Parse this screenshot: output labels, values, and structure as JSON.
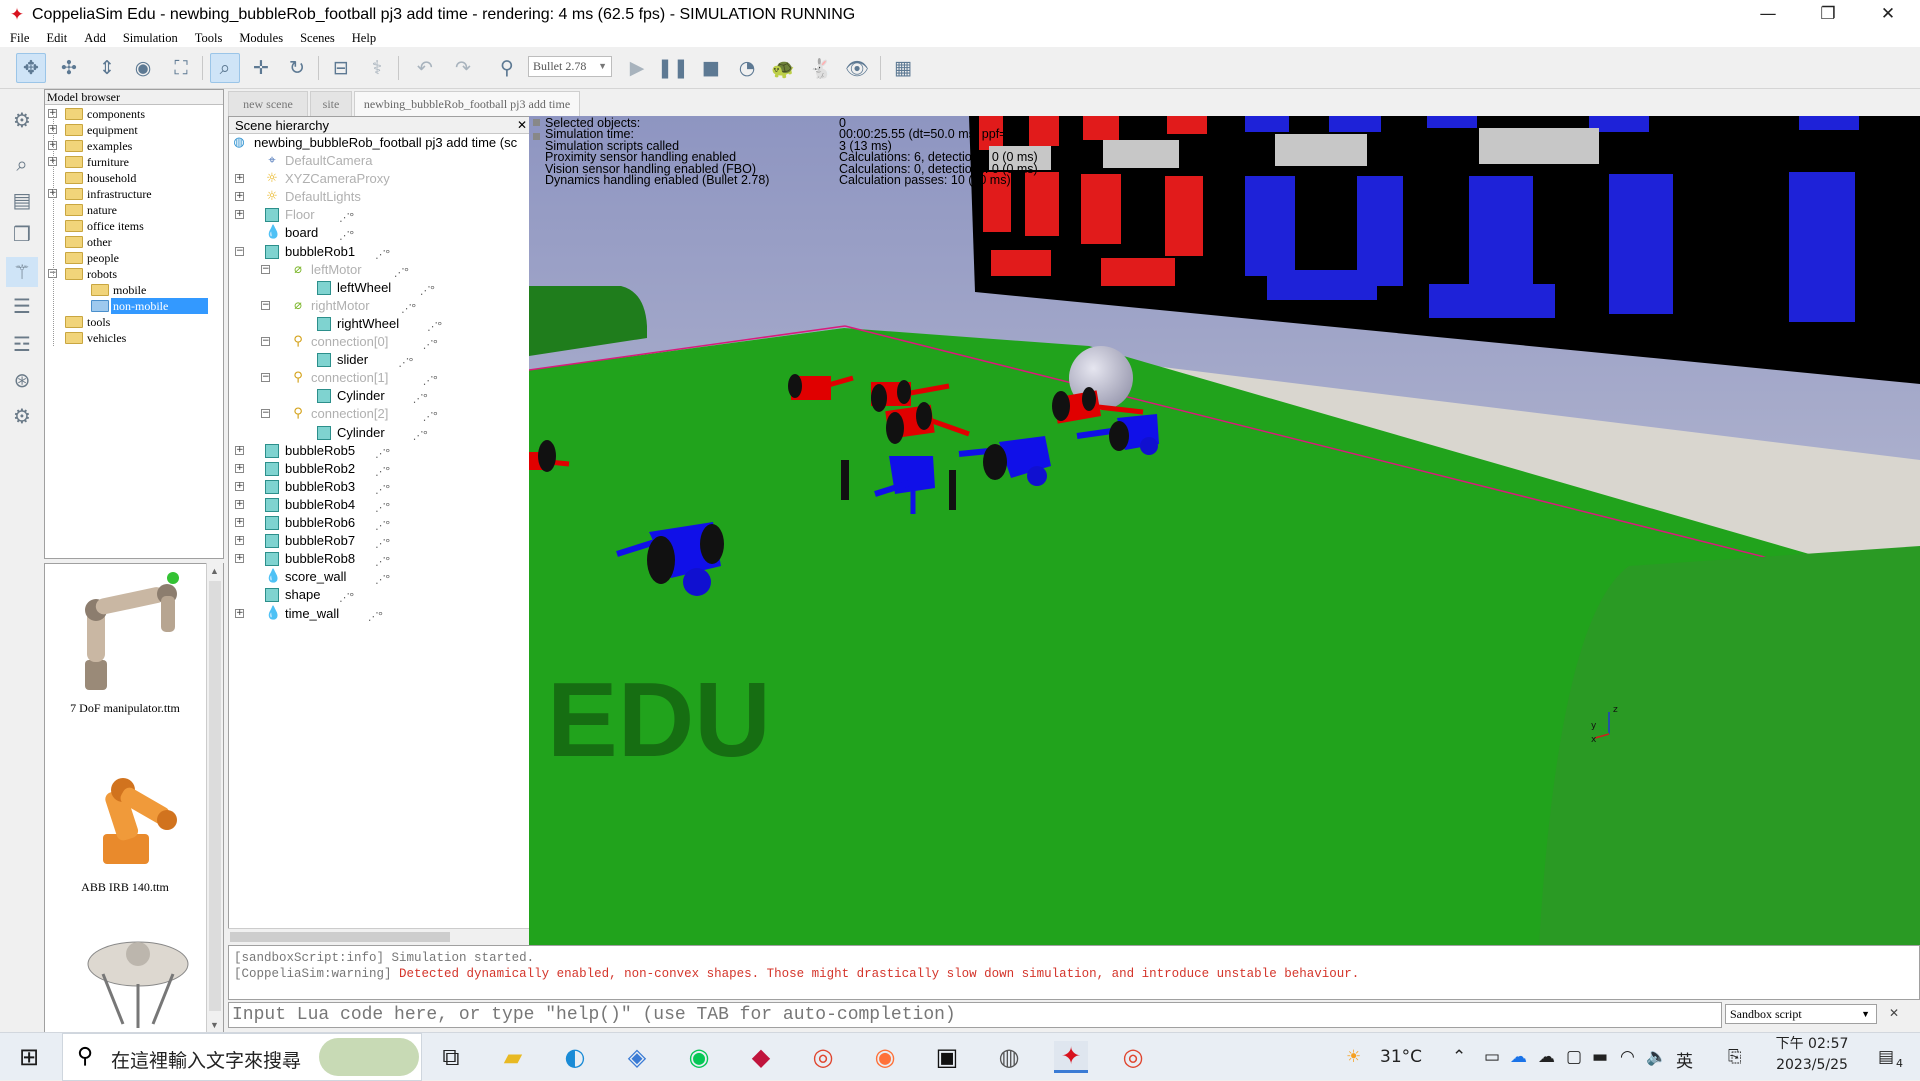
{
  "window": {
    "title": "CoppeliaSim Edu - newbing_bubbleRob_football pj3 add time - rendering: 4 ms (62.5 fps) - SIMULATION RUNNING",
    "minimize": "—",
    "maximize": "❐",
    "close": "✕"
  },
  "menu": [
    "File",
    "Edit",
    "Add",
    "Simulation",
    "Tools",
    "Modules",
    "Scenes",
    "Help"
  ],
  "toolbar": {
    "engine": "Bullet 2.78",
    "icons": [
      "camera-pan-icon",
      "camera-rotate-icon",
      "camera-shift-icon",
      "camera-angle-icon",
      "fit-to-view-icon",
      "click-select-icon",
      "object-shift-icon",
      "object-rotate-icon",
      "assemble-icon",
      "transfer-dna-icon",
      "undo-icon",
      "redo-icon",
      "engine-settings-icon",
      "start-simulation-icon",
      "pause-simulation-icon",
      "stop-simulation-icon",
      "real-time-icon",
      "slow-down-icon",
      "speed-up-icon",
      "visualization-icon",
      "page-selector-icon"
    ]
  },
  "model_browser": {
    "header": "Model browser",
    "folders": [
      {
        "label": "components",
        "expander": "+"
      },
      {
        "label": "equipment",
        "expander": "+"
      },
      {
        "label": "examples",
        "expander": "+"
      },
      {
        "label": "furniture",
        "expander": "+"
      },
      {
        "label": "household",
        "expander": ""
      },
      {
        "label": "infrastructure",
        "expander": "+"
      },
      {
        "label": "nature",
        "expander": ""
      },
      {
        "label": "office items",
        "expander": ""
      },
      {
        "label": "other",
        "expander": ""
      },
      {
        "label": "people",
        "expander": ""
      },
      {
        "label": "robots",
        "expander": "−"
      },
      {
        "label": "mobile",
        "expander": "",
        "child": true
      },
      {
        "label": "non-mobile",
        "expander": "",
        "child": true,
        "selected": true
      },
      {
        "label": "tools",
        "expander": ""
      },
      {
        "label": "vehicles",
        "expander": ""
      }
    ],
    "thumbnails": [
      "7 DoF manipulator.ttm",
      "ABB IRB 140.ttm"
    ]
  },
  "scene_tabs": [
    "new scene",
    "site",
    "newbing_bubbleRob_football pj3 add time"
  ],
  "hierarchy": {
    "header": "Scene hierarchy",
    "close": "✕",
    "root": "newbing_bubbleRob_football pj3 add time (sc",
    "items": [
      {
        "label": "DefaultCamera",
        "icon": "cam",
        "grey": true,
        "depth": 1,
        "exp": ""
      },
      {
        "label": "XYZCameraProxy",
        "icon": "light",
        "grey": true,
        "depth": 1,
        "exp": "+"
      },
      {
        "label": "DefaultLights",
        "icon": "light",
        "grey": true,
        "depth": 1,
        "exp": "+"
      },
      {
        "label": "Floor",
        "icon": "cube",
        "grey": true,
        "depth": 1,
        "exp": "+",
        "script": true
      },
      {
        "label": "board",
        "icon": "shape",
        "grey": false,
        "depth": 1,
        "exp": "",
        "script": true
      },
      {
        "label": "bubbleRob1",
        "icon": "cube",
        "grey": false,
        "depth": 1,
        "exp": "−",
        "script": true
      },
      {
        "label": "leftMotor",
        "icon": "joint",
        "grey": true,
        "depth": 2,
        "exp": "−",
        "script": true
      },
      {
        "label": "leftWheel",
        "icon": "cube",
        "grey": false,
        "depth": 3,
        "exp": "",
        "script": true
      },
      {
        "label": "rightMotor",
        "icon": "joint",
        "grey": true,
        "depth": 2,
        "exp": "−",
        "script": true
      },
      {
        "label": "rightWheel",
        "icon": "cube",
        "grey": false,
        "depth": 3,
        "exp": "",
        "script": true
      },
      {
        "label": "connection[0]",
        "icon": "force",
        "grey": true,
        "depth": 2,
        "exp": "−",
        "script": true
      },
      {
        "label": "slider",
        "icon": "cube",
        "grey": false,
        "depth": 3,
        "exp": "",
        "script": true
      },
      {
        "label": "connection[1]",
        "icon": "force",
        "grey": true,
        "depth": 2,
        "exp": "−",
        "script": true
      },
      {
        "label": "Cylinder",
        "icon": "cube",
        "grey": false,
        "depth": 3,
        "exp": "",
        "script": true
      },
      {
        "label": "connection[2]",
        "icon": "force",
        "grey": true,
        "depth": 2,
        "exp": "−",
        "script": true
      },
      {
        "label": "Cylinder",
        "icon": "cube",
        "grey": false,
        "depth": 3,
        "exp": "",
        "script": true
      },
      {
        "label": "bubbleRob5",
        "icon": "cube",
        "grey": false,
        "depth": 1,
        "exp": "+",
        "script": true
      },
      {
        "label": "bubbleRob2",
        "icon": "cube",
        "grey": false,
        "depth": 1,
        "exp": "+",
        "script": true
      },
      {
        "label": "bubbleRob3",
        "icon": "cube",
        "grey": false,
        "depth": 1,
        "exp": "+",
        "script": true
      },
      {
        "label": "bubbleRob4",
        "icon": "cube",
        "grey": false,
        "depth": 1,
        "exp": "+",
        "script": true
      },
      {
        "label": "bubbleRob6",
        "icon": "cube",
        "grey": false,
        "depth": 1,
        "exp": "+",
        "script": true
      },
      {
        "label": "bubbleRob7",
        "icon": "cube",
        "grey": false,
        "depth": 1,
        "exp": "+",
        "script": true
      },
      {
        "label": "bubbleRob8",
        "icon": "cube",
        "grey": false,
        "depth": 1,
        "exp": "+",
        "script": true
      },
      {
        "label": "score_wall",
        "icon": "shape",
        "grey": false,
        "depth": 1,
        "exp": "",
        "script": true
      },
      {
        "label": "shape",
        "icon": "cube",
        "grey": false,
        "depth": 1,
        "exp": "",
        "script": true
      },
      {
        "label": "time_wall",
        "icon": "shape",
        "grey": false,
        "depth": 1,
        "exp": "+",
        "script": true
      }
    ]
  },
  "sim_info": [
    {
      "k": "Selected objects:",
      "v": "0"
    },
    {
      "k": "Simulation time:",
      "v": "00:00:25.55 (dt=50.0 ms, ppf=1)"
    },
    {
      "k": "Simulation scripts called",
      "v": "3 (13 ms)"
    },
    {
      "k": "Proximity sensor handling enabled",
      "v": "Calculations: 6, detections: 0 (0 ms)"
    },
    {
      "k": "Vision sensor handling enabled (FBO)",
      "v": "Calculations: 0, detections: 0 (0 ms)"
    },
    {
      "k": "Dynamics handling enabled (Bullet 2.78)",
      "v": "Calculation passes: 10 (10 ms)"
    }
  ],
  "viewport": {
    "watermark": "EDU",
    "axis_labels": [
      "z",
      "y",
      "x"
    ],
    "colors": {
      "field": "#21a31c",
      "red_team": "#e00000",
      "blue_team": "#0000e0",
      "ball": "#b9b9c9",
      "board": "#000000"
    }
  },
  "console": {
    "line1_tag": "[sandboxScript:info]",
    "line1_msg": "Simulation started.",
    "line2_tag": "[CoppeliaSim:warning]",
    "line2_msg": "Detected dynamically enabled, non-convex shapes. Those might drastically slow down simulation, and introduce unstable behaviour."
  },
  "lua_input": {
    "placeholder": "Input Lua code here, or type \"help()\" (use TAB for auto-completion)"
  },
  "script_selector": {
    "value": "Sandbox script",
    "close": "✕"
  },
  "taskbar": {
    "search_placeholder": "在這裡輸入文字來搜尋",
    "weather": "31°C",
    "ime": "英",
    "time": "下午 02:57",
    "date": "2023/5/25",
    "notifications": "4"
  }
}
